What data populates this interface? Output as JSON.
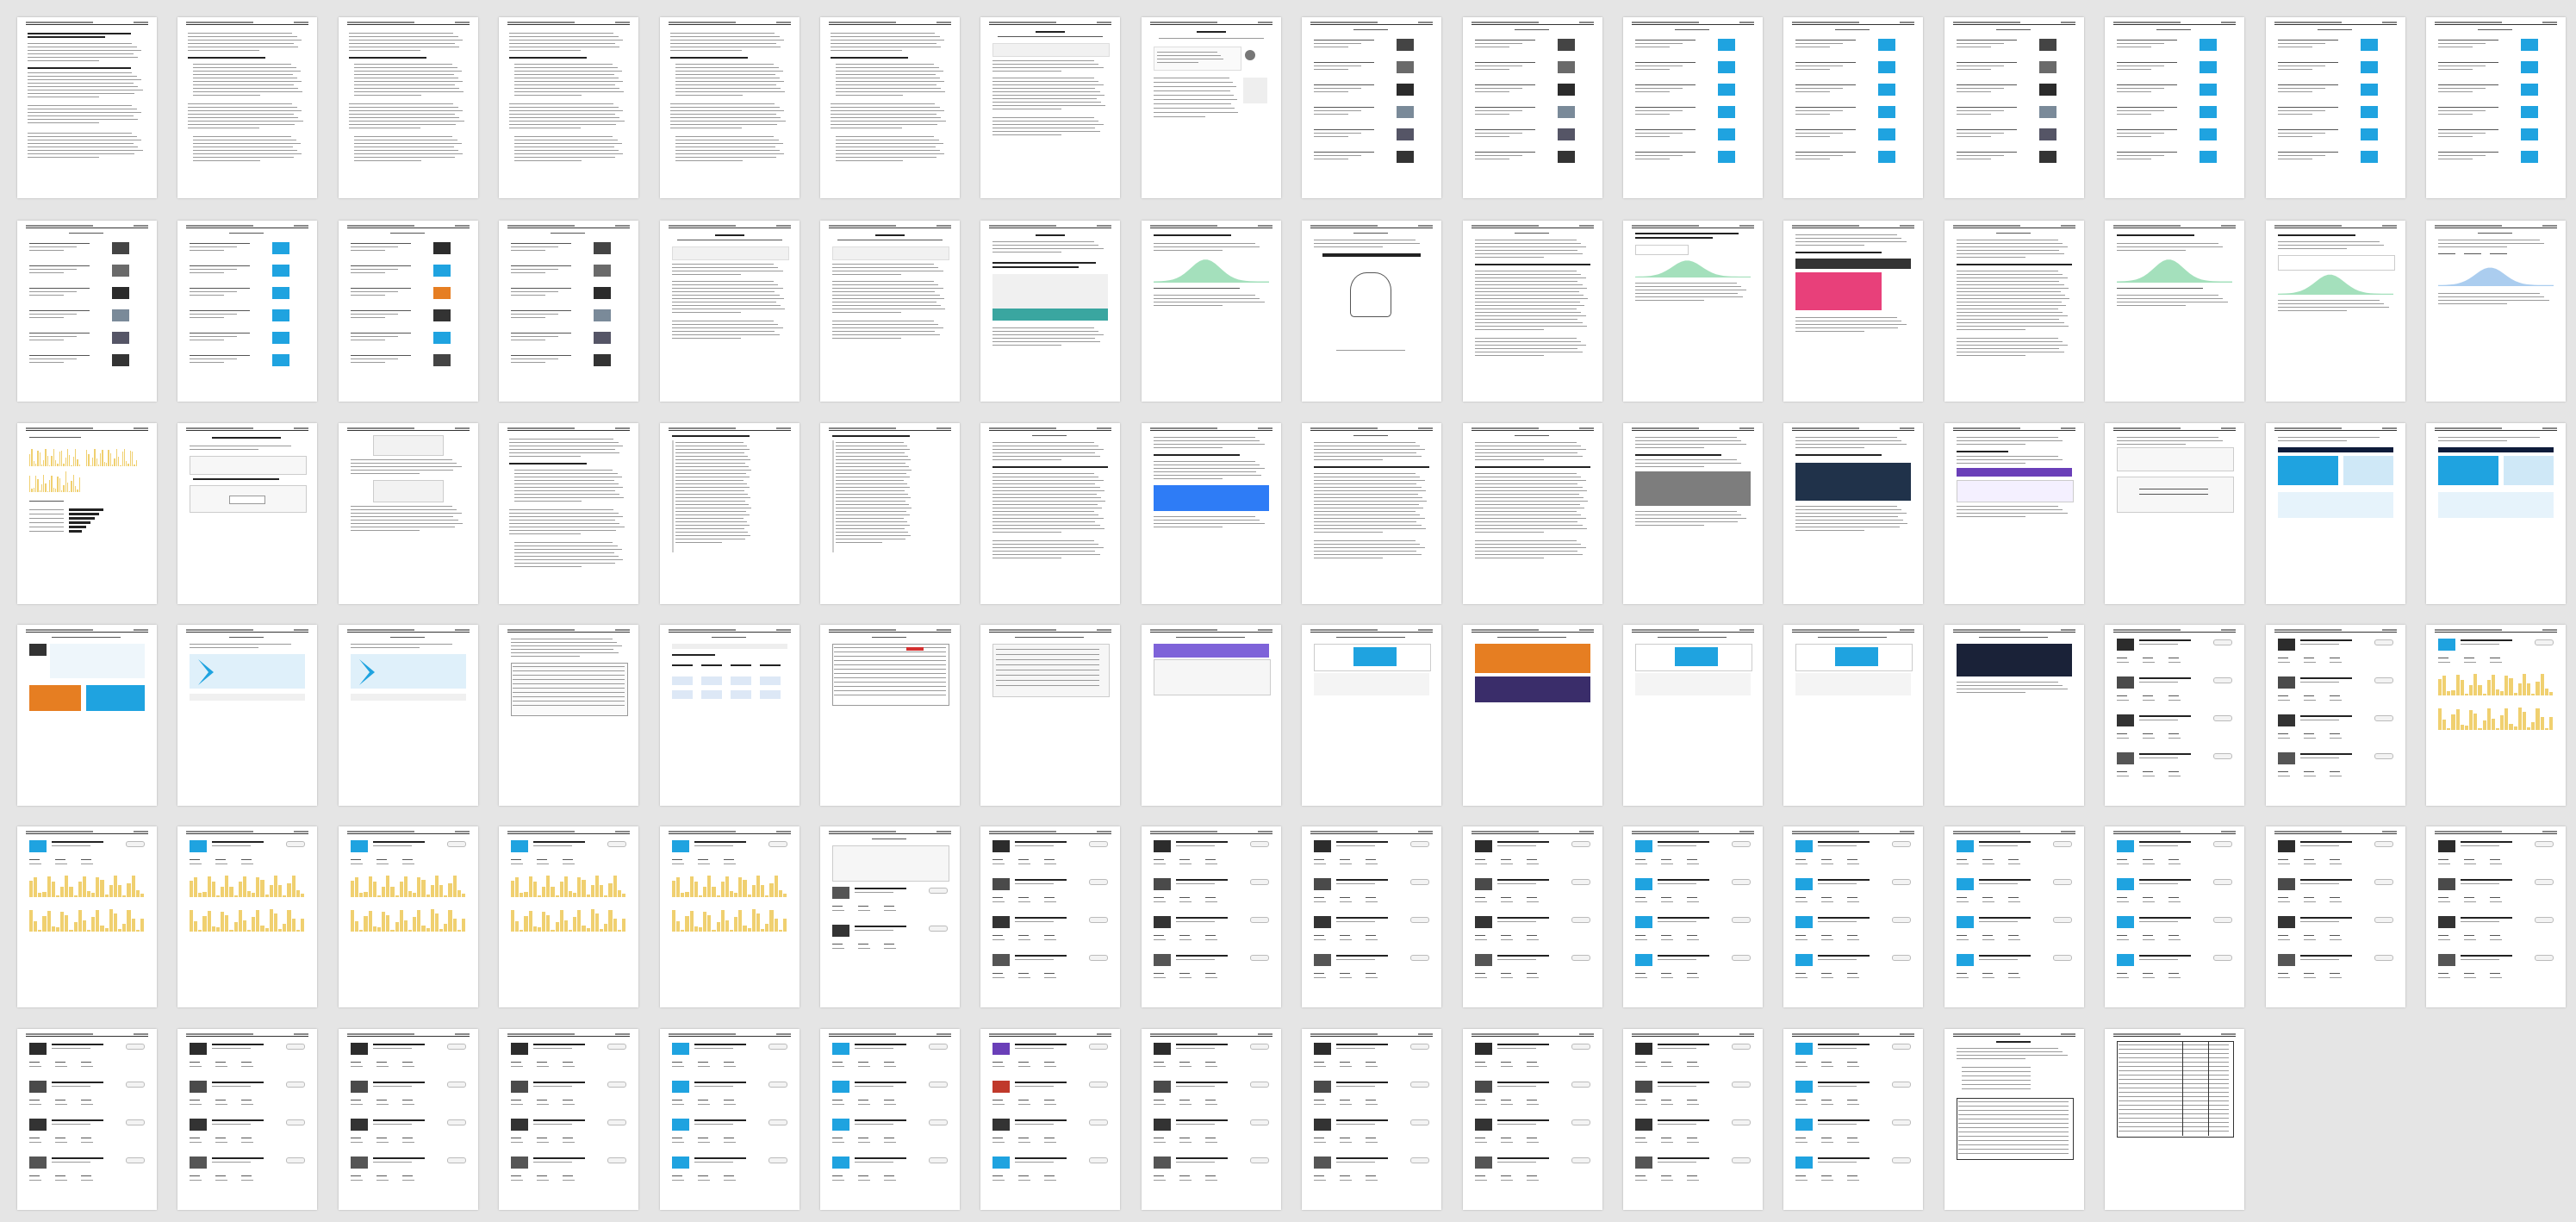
{
  "document": {
    "page_count": 94,
    "columns": 16,
    "header_text": "",
    "page_numbers": []
  },
  "layouts": {
    "p1": "academic",
    "p2": "text",
    "p3": "text",
    "p4": "text",
    "p5": "text",
    "p6": "text",
    "p7": "medium-text",
    "p8": "medium-profile",
    "p9": "list-thumbs",
    "p10": "list-thumbs",
    "p11": "list-blue",
    "p12": "list-blue",
    "p13": "list-thumbs",
    "p14": "list-blue",
    "p15": "list-blue",
    "p16": "list-blue",
    "p17": "list-thumbs",
    "p18": "list-blue",
    "p19": "list-thumbs-color",
    "p20": "list-thumbs",
    "p21": "medium-text",
    "p22": "medium-text",
    "p23": "article-image-teal",
    "p24": "stats-chart-green",
    "p25": "sketch",
    "p26": "article-text",
    "p27": "article-chart",
    "p28": "article-pink",
    "p29": "article-text",
    "p30": "stats-chart-green",
    "p31": "stats-card",
    "p32": "stats-chart",
    "p33": "stats-bars",
    "p34": "form",
    "p35": "form-text",
    "p36": "text",
    "p37": "code",
    "p38": "code",
    "p39": "article-text",
    "p40": "article-blue",
    "p41": "article-text",
    "p42": "article-text",
    "p43": "article-photo",
    "p44": "article-photo-dark",
    "p45": "article-purple",
    "p46": "boost",
    "p47": "blue-gallery",
    "p48": "blue-gallery",
    "p49": "mixed-gallery",
    "p50": "blue-card",
    "p51": "blue-card",
    "p52": "text-table",
    "p53": "infographic",
    "p54": "table-red",
    "p55": "screenshot",
    "p56": "screenshot-purple",
    "p57": "screenshot-blue",
    "p58": "screenshot-orange",
    "p59": "screenshot-blue",
    "p60": "screenshot-blue",
    "p61": "screenshot-dark",
    "p62": "stats-dark",
    "p63": "stats-dark",
    "p64": "stats-yellow",
    "p65": "stats-yellow",
    "p66": "stats-yellow",
    "p67": "stats-yellow",
    "p68": "stats-yellow",
    "p69": "stats-yellow",
    "p70": "stats-list",
    "p71": "stats-dark",
    "p72": "stats-dark",
    "p73": "stats-dark",
    "p74": "stats-dark",
    "p75": "stats-blue",
    "p76": "stats-blue",
    "p77": "stats-blue",
    "p78": "stats-blue",
    "p79": "stats-dark",
    "p80": "stats-dark",
    "p81": "stats-dark",
    "p82": "stats-dark",
    "p83": "stats-dark",
    "p84": "stats-dark",
    "p85": "stats-blue",
    "p86": "stats-blue",
    "p87": "stats-purple",
    "p88": "stats-dark",
    "p89": "stats-dark",
    "p90": "stats-dark",
    "p91": "stats-dark",
    "p92": "stats-blue",
    "p93": "table-summary",
    "p94": "table-grid"
  },
  "colors": {
    "background": "#e5e5e5",
    "page": "#ffffff",
    "medium_blue": "#1fa3e0",
    "chart_yellow": "#f0d070",
    "chart_green": "#7ed3a0",
    "accent_pink": "#e8407a",
    "accent_purple": "#6a3fb8",
    "accent_orange": "#e67e22",
    "dark_photo": "#2b2b2b",
    "teal": "#3aa6a0",
    "highlight_yellow": "#d7c400"
  }
}
